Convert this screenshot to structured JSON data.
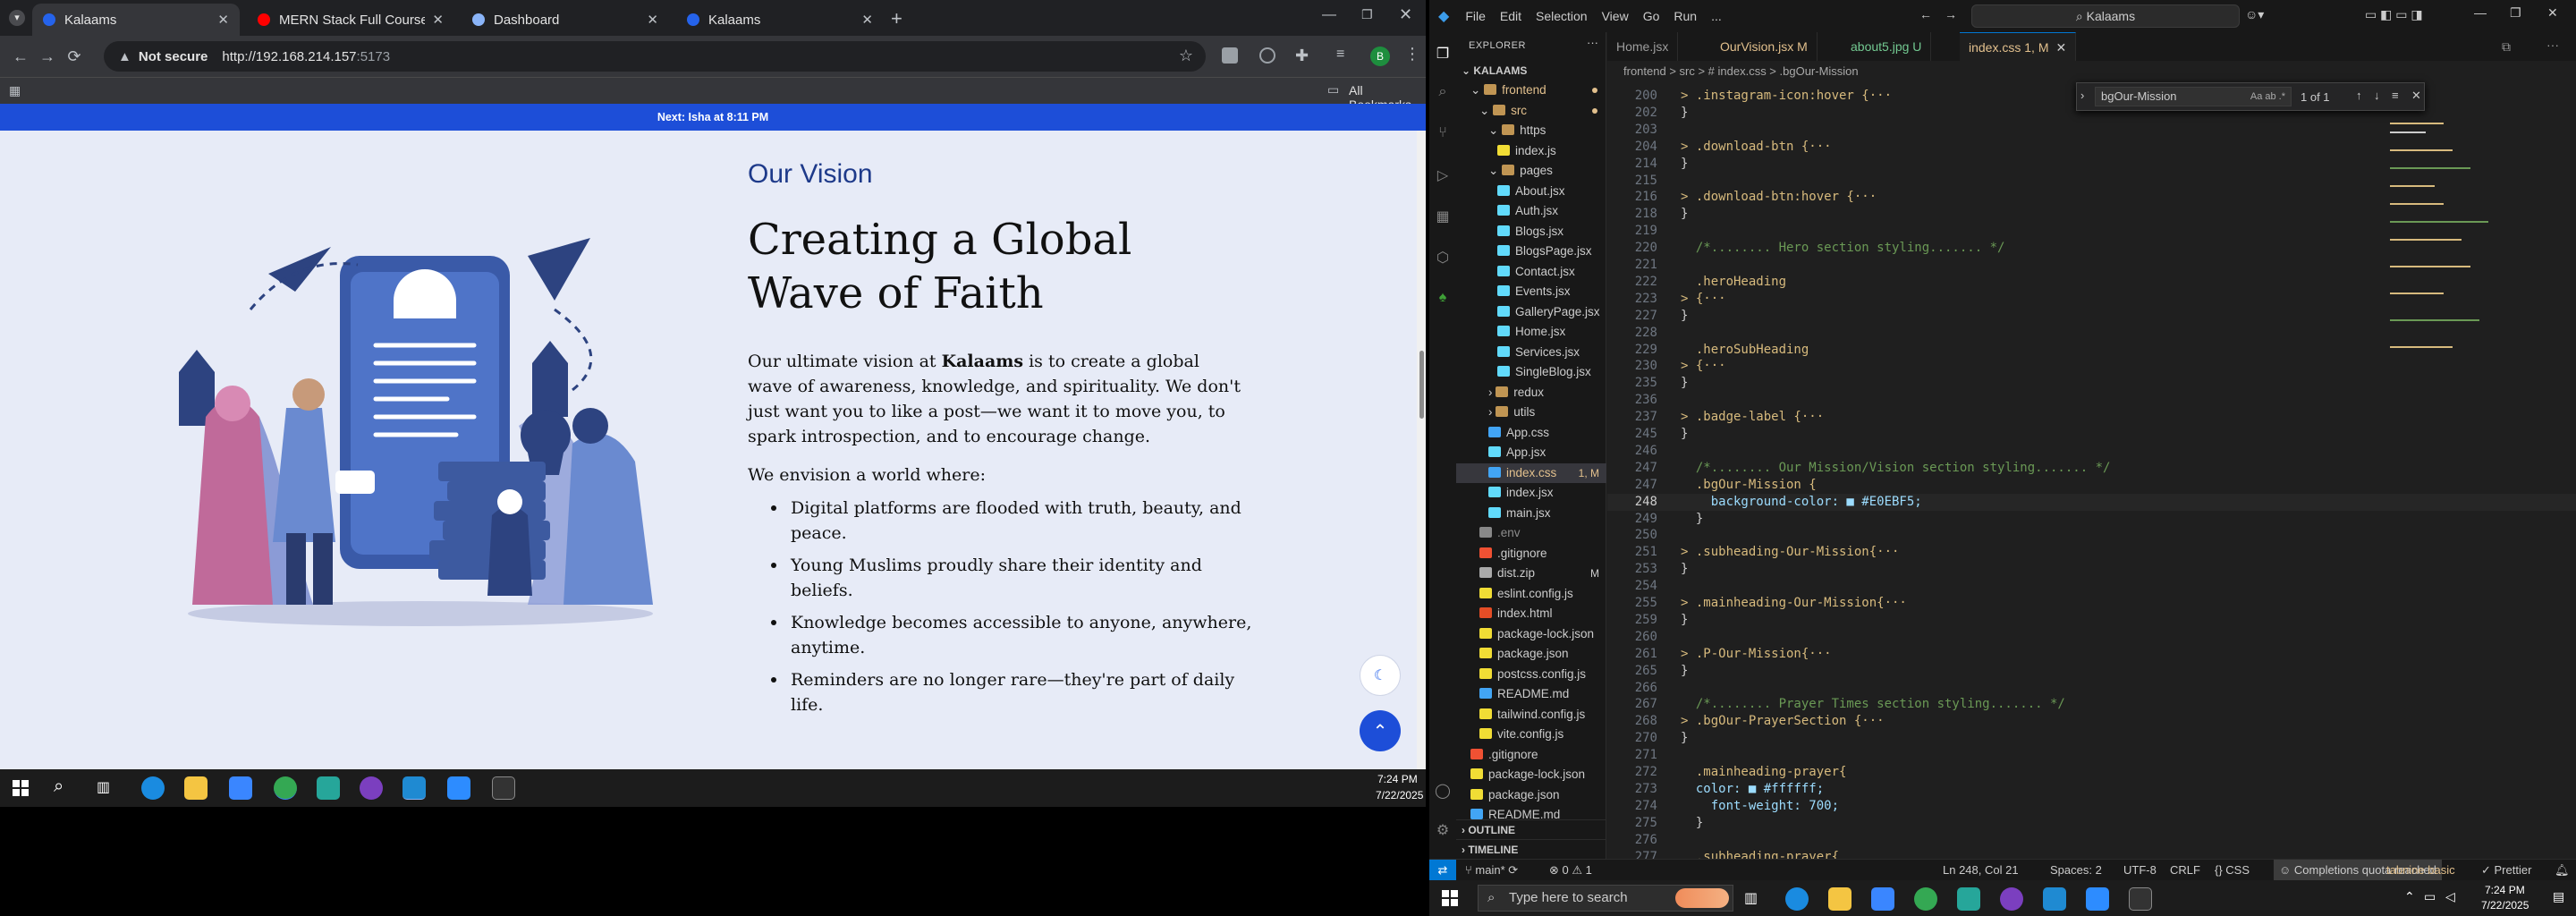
{
  "browser": {
    "tabs": [
      {
        "title": "Kalaams",
        "color": "#2563eb"
      },
      {
        "title": "MERN Stack Full Course - ECom",
        "color": "#ff0000"
      },
      {
        "title": "Dashboard",
        "color": "#8ab4f8"
      },
      {
        "title": "Kalaams",
        "color": "#2563eb"
      }
    ],
    "new_tab": "+",
    "address": {
      "warning": "Not secure",
      "host": "http://192.168.214.157",
      "port": ":5173"
    },
    "all_bookmarks": "All Bookmarks",
    "profile_initial": "B"
  },
  "banner": {
    "text": "Next: Isha at 8:11 PM"
  },
  "vision": {
    "eyebrow": "Our Vision",
    "heading": "Creating a Global Wave of Faith",
    "para_before": "Our ultimate vision at ",
    "para_brand": "Kalaams",
    "para_after": " is to create a global wave of awareness, knowledge, and spirituality. We don't just want you to like a post—we want it to move you, to spark introspection, and to encourage change.",
    "envision": "We envision a world where:",
    "bullets": [
      "Digital platforms are flooded with truth, beauty, and peace.",
      "Young Muslims proudly share their identity and beliefs.",
      "Knowledge becomes accessible to anyone, anywhere, anytime.",
      "Reminders are no longer rare—they're part of daily life."
    ]
  },
  "taskbar_left": {
    "time": "7:24 PM",
    "date": "7/22/2025"
  },
  "vscode": {
    "menus": [
      "File",
      "Edit",
      "Selection",
      "View",
      "Go",
      "Run",
      "..."
    ],
    "search": "Kalaams",
    "explorer_label": "EXPLORER",
    "root": "KALAAMS",
    "tree": [
      {
        "name": "frontend",
        "type": "folder",
        "indent": 1,
        "color": "#e2c08d",
        "dot": "#e2c08d"
      },
      {
        "name": "src",
        "type": "folder",
        "indent": 2,
        "color": "#e2c08d",
        "dot": "#e2c08d"
      },
      {
        "name": "https",
        "type": "folder",
        "indent": 3,
        "color": "#ccc",
        "dot": ""
      },
      {
        "name": "index.js",
        "type": "js",
        "indent": 4,
        "color": "#ccc",
        "dot": ""
      },
      {
        "name": "pages",
        "type": "folder",
        "indent": 3,
        "color": "#ccc",
        "dot": ""
      },
      {
        "name": "About.jsx",
        "type": "jsx",
        "indent": 4,
        "color": "#ccc",
        "dot": ""
      },
      {
        "name": "Auth.jsx",
        "type": "jsx",
        "indent": 4,
        "color": "#ccc",
        "dot": ""
      },
      {
        "name": "Blogs.jsx",
        "type": "jsx",
        "indent": 4,
        "color": "#ccc",
        "dot": ""
      },
      {
        "name": "BlogsPage.jsx",
        "type": "jsx",
        "indent": 4,
        "color": "#ccc",
        "dot": ""
      },
      {
        "name": "Contact.jsx",
        "type": "jsx",
        "indent": 4,
        "color": "#ccc",
        "dot": ""
      },
      {
        "name": "Events.jsx",
        "type": "jsx",
        "indent": 4,
        "color": "#ccc",
        "dot": ""
      },
      {
        "name": "GalleryPage.jsx",
        "type": "jsx",
        "indent": 4,
        "color": "#ccc",
        "dot": ""
      },
      {
        "name": "Home.jsx",
        "type": "jsx",
        "indent": 4,
        "color": "#ccc",
        "dot": ""
      },
      {
        "name": "Services.jsx",
        "type": "jsx",
        "indent": 4,
        "color": "#ccc",
        "dot": ""
      },
      {
        "name": "SingleBlog.jsx",
        "type": "jsx",
        "indent": 4,
        "color": "#ccc",
        "dot": ""
      },
      {
        "name": "redux",
        "type": "folder",
        "indent": 3,
        "color": "#ccc",
        "dot": ""
      },
      {
        "name": "utils",
        "type": "folder",
        "indent": 3,
        "color": "#ccc",
        "dot": ""
      },
      {
        "name": "App.css",
        "type": "css",
        "indent": 3,
        "color": "#ccc",
        "dot": ""
      },
      {
        "name": "App.jsx",
        "type": "jsx",
        "indent": 3,
        "color": "#ccc",
        "dot": ""
      },
      {
        "name": "index.css",
        "type": "css",
        "indent": 3,
        "color": "#e2c08d",
        "badge": "1, M",
        "selected": true
      },
      {
        "name": "index.jsx",
        "type": "jsx",
        "indent": 3,
        "color": "#ccc",
        "dot": ""
      },
      {
        "name": "main.jsx",
        "type": "jsx",
        "indent": 3,
        "color": "#ccc",
        "dot": ""
      },
      {
        "name": ".env",
        "type": "env",
        "indent": 2,
        "color": "#8c8c8c",
        "dot": ""
      },
      {
        "name": ".gitignore",
        "type": "git",
        "indent": 2,
        "color": "#ccc",
        "dot": ""
      },
      {
        "name": "dist.zip",
        "type": "zip",
        "indent": 2,
        "color": "#ccc",
        "badge": "M"
      },
      {
        "name": "eslint.config.js",
        "type": "js",
        "indent": 2,
        "color": "#ccc",
        "dot": ""
      },
      {
        "name": "index.html",
        "type": "html",
        "indent": 2,
        "color": "#ccc",
        "dot": ""
      },
      {
        "name": "package-lock.json",
        "type": "json",
        "indent": 2,
        "color": "#ccc",
        "dot": ""
      },
      {
        "name": "package.json",
        "type": "json",
        "indent": 2,
        "color": "#ccc",
        "dot": ""
      },
      {
        "name": "postcss.config.js",
        "type": "js",
        "indent": 2,
        "color": "#ccc",
        "dot": ""
      },
      {
        "name": "README.md",
        "type": "md",
        "indent": 2,
        "color": "#ccc",
        "dot": ""
      },
      {
        "name": "tailwind.config.js",
        "type": "js",
        "indent": 2,
        "color": "#ccc",
        "dot": ""
      },
      {
        "name": "vite.config.js",
        "type": "js",
        "indent": 2,
        "color": "#ccc",
        "dot": ""
      },
      {
        "name": ".gitignore",
        "type": "git",
        "indent": 1,
        "color": "#ccc",
        "dot": ""
      },
      {
        "name": "package-lock.json",
        "type": "json",
        "indent": 1,
        "color": "#ccc",
        "dot": ""
      },
      {
        "name": "package.json",
        "type": "json",
        "indent": 1,
        "color": "#ccc",
        "dot": ""
      },
      {
        "name": "README.md",
        "type": "md",
        "indent": 1,
        "color": "#ccc",
        "dot": ""
      }
    ],
    "outline": "OUTLINE",
    "timeline": "TIMELINE",
    "editor_tabs": [
      {
        "label": "Home.jsx",
        "color": "#9d9d9d"
      },
      {
        "label": "OurVision.jsx M",
        "color": "#e2c08d"
      },
      {
        "label": "about5.jpg U",
        "color": "#73c991"
      },
      {
        "label": "index.css 1, M",
        "color": "#e2c08d",
        "active": true
      }
    ],
    "breadcrumb": "frontend > src > # index.css > .bgOur-Mission",
    "find": {
      "query": "bgOur-Mission",
      "opts": "Aa  ab  .*",
      "count": "1 of 1"
    },
    "code": [
      {
        "n": "200",
        "t": "> .instagram-icon:hover {···"
      },
      {
        "n": "202",
        "t": "}"
      },
      {
        "n": "203",
        "t": ""
      },
      {
        "n": "204",
        "t": "> .download-btn {···"
      },
      {
        "n": "214",
        "t": "}"
      },
      {
        "n": "215",
        "t": ""
      },
      {
        "n": "216",
        "t": "> .download-btn:hover {···"
      },
      {
        "n": "218",
        "t": "}"
      },
      {
        "n": "219",
        "t": ""
      },
      {
        "n": "220",
        "t": "  /*........ Hero section styling....... */"
      },
      {
        "n": "221",
        "t": ""
      },
      {
        "n": "222",
        "t": "  .heroHeading"
      },
      {
        "n": "223",
        "t": "> {···"
      },
      {
        "n": "227",
        "t": "}"
      },
      {
        "n": "228",
        "t": ""
      },
      {
        "n": "229",
        "t": "  .heroSubHeading"
      },
      {
        "n": "230",
        "t": "> {···"
      },
      {
        "n": "235",
        "t": "}"
      },
      {
        "n": "236",
        "t": ""
      },
      {
        "n": "237",
        "t": "> .badge-label {···"
      },
      {
        "n": "245",
        "t": "}"
      },
      {
        "n": "246",
        "t": ""
      },
      {
        "n": "247",
        "t": "  /*........ Our Mission/Vision section styling....... */"
      },
      {
        "n": "247",
        "t": "  .bgOur-Mission {"
      },
      {
        "n": "248",
        "t": "    background-color: ■ #E0EBF5;"
      },
      {
        "n": "249",
        "t": "  }"
      },
      {
        "n": "250",
        "t": ""
      },
      {
        "n": "251",
        "t": "> .subheading-Our-Mission{···"
      },
      {
        "n": "253",
        "t": "}"
      },
      {
        "n": "254",
        "t": ""
      },
      {
        "n": "255",
        "t": "> .mainheading-Our-Mission{···"
      },
      {
        "n": "259",
        "t": "}"
      },
      {
        "n": "260",
        "t": ""
      },
      {
        "n": "261",
        "t": "> .P-Our-Mission{···"
      },
      {
        "n": "265",
        "t": "}"
      },
      {
        "n": "266",
        "t": ""
      },
      {
        "n": "267",
        "t": "  /*........ Prayer Times section styling....... */"
      },
      {
        "n": "268",
        "t": "> .bgOur-PrayerSection {···"
      },
      {
        "n": "270",
        "t": "}"
      },
      {
        "n": "271",
        "t": ""
      },
      {
        "n": "272",
        "t": "  .mainheading-prayer{"
      },
      {
        "n": "273",
        "t": "  color: ■ #ffffff;"
      },
      {
        "n": "274",
        "t": "    font-weight: 700;"
      },
      {
        "n": "275",
        "t": "  }"
      },
      {
        "n": "276",
        "t": ""
      },
      {
        "n": "277",
        "t": "  .subheading-prayer{"
      }
    ],
    "status": {
      "branch": "main*",
      "problems": "⊗ 0 ⚠ 1",
      "position": "Ln 248, Col 21",
      "spaces": "Spaces: 2",
      "encoding": "UTF-8",
      "eol": "CRLF",
      "language": "CSS",
      "completions": "Completions quota reached",
      "tabnine": "tabnine basic",
      "prettier": "✓ Prettier"
    }
  },
  "taskbar_right": {
    "search": "Type here to search",
    "time": "7:24 PM",
    "date": "7/22/2025"
  }
}
